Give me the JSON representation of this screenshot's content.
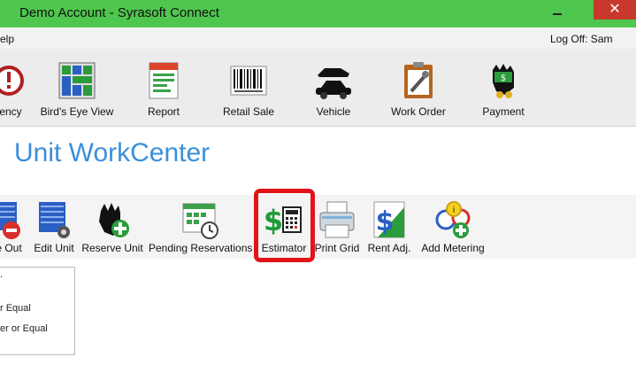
{
  "window": {
    "title": "Demo Account - Syrasoft Connect",
    "close": "✕"
  },
  "menu": {
    "help": "elp",
    "logoff": "Log Off: Sam"
  },
  "toolbar": {
    "items": [
      {
        "label": "ency"
      },
      {
        "label": "Bird's Eye View"
      },
      {
        "label": "Report"
      },
      {
        "label": "Retail Sale"
      },
      {
        "label": "Vehicle"
      },
      {
        "label": "Work Order"
      },
      {
        "label": "Payment"
      }
    ]
  },
  "page": {
    "title": "Unit WorkCenter"
  },
  "actions": {
    "items": [
      {
        "label": "e Out"
      },
      {
        "label": "Edit Unit"
      },
      {
        "label": "Reserve Unit"
      },
      {
        "label": "Pending Reservations"
      },
      {
        "label": "Estimator"
      },
      {
        "label": "Print Grid"
      },
      {
        "label": "Rent Adj."
      },
      {
        "label": "Add Metering"
      }
    ]
  },
  "filters": {
    "lines": [
      ".",
      "r Equal",
      "er or Equal"
    ]
  },
  "colors": {
    "titlebar": "#4fc64d",
    "accent": "#3b8fd9",
    "highlight": "#e2141a",
    "close": "#c8392c"
  }
}
